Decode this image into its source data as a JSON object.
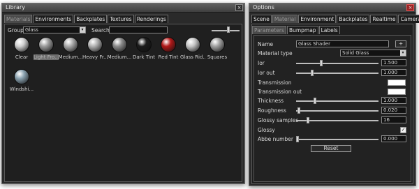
{
  "library": {
    "title": "Library",
    "tabs": [
      {
        "label": "Materials",
        "active": true
      },
      {
        "label": "Environments",
        "active": false
      },
      {
        "label": "Backplates",
        "active": false
      },
      {
        "label": "Textures",
        "active": false
      },
      {
        "label": "Renderings",
        "active": false
      }
    ],
    "group_label": "Group",
    "group_value": "Glass",
    "search_label": "Search",
    "search_value": "",
    "thumb_size_level": 0.6,
    "materials": [
      {
        "label": "Clear",
        "color": "#cfcfcf",
        "selected": false
      },
      {
        "label": "Light Fro...",
        "color": "#9a9a9a",
        "selected": true
      },
      {
        "label": "Medium...",
        "color": "#a9a9a9",
        "selected": false
      },
      {
        "label": "Heavy Fr...",
        "color": "#b0b0b0",
        "selected": false
      },
      {
        "label": "Medium...",
        "color": "#8a8a8a",
        "selected": false
      },
      {
        "label": "Dark Tint",
        "color": "#1c1c1c",
        "selected": false
      },
      {
        "label": "Red Tint",
        "color": "#b01818",
        "selected": false
      },
      {
        "label": "Glass Rid...",
        "color": "#c4c4c4",
        "selected": false
      },
      {
        "label": "Squares",
        "color": "#a0a0a0",
        "selected": false
      },
      {
        "label": "Windshi...",
        "color": "#8aa2b0",
        "selected": false
      }
    ]
  },
  "options": {
    "title": "Options",
    "tabs": [
      {
        "label": "Scene",
        "active": false
      },
      {
        "label": "Material",
        "active": true
      },
      {
        "label": "Environment",
        "active": false
      },
      {
        "label": "Backplates",
        "active": false
      },
      {
        "label": "Realtime",
        "active": false
      },
      {
        "label": "Camera",
        "active": false
      }
    ],
    "subtabs": [
      {
        "label": "Parameters",
        "active": true
      },
      {
        "label": "Bumpmap",
        "active": false
      },
      {
        "label": "Labels",
        "active": false
      }
    ],
    "name_label": "Name",
    "name_value": "Glass Shader",
    "add_button": "+",
    "material_type_label": "Material type",
    "material_type_value": "Solid Glass",
    "ior_label": "Ior",
    "ior_value": "1.500",
    "ior_level": 0.3,
    "ior_out_label": "Ior out",
    "ior_out_value": "1.000",
    "ior_out_level": 0.18,
    "transmission_label": "Transmission",
    "transmission_color": "#ffffff",
    "transmission_out_label": "Transmission out",
    "transmission_out_color": "#ffffff",
    "thickness_label": "Thickness",
    "thickness_value": "1.000",
    "thickness_level": 0.22,
    "roughness_label": "Roughness",
    "roughness_value": "0.020",
    "roughness_level": 0.02,
    "glossy_samples_label": "Glossy samples",
    "glossy_samples_value": "16",
    "glossy_samples_level": 0.13,
    "glossy_label": "Glossy",
    "glossy_checked": "✓",
    "abbe_label": "Abbe number",
    "abbe_value": "0.000",
    "abbe_level": 0.0,
    "reset_label": "Reset"
  },
  "icons": {
    "close": "×",
    "dropdown": "▾"
  }
}
